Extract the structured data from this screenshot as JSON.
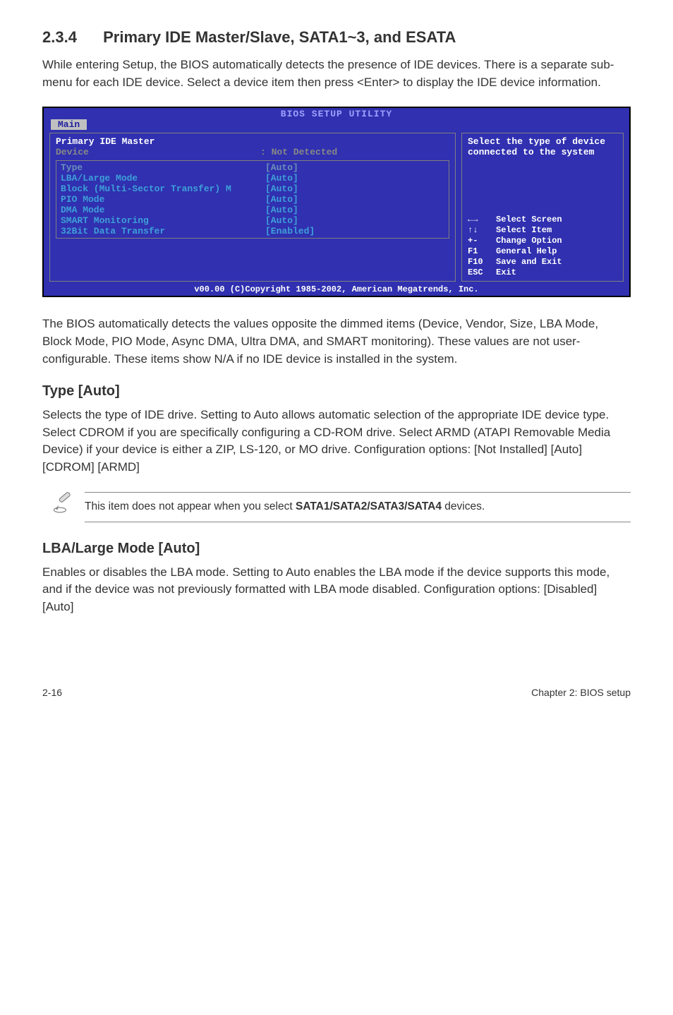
{
  "section": {
    "number": "2.3.4",
    "title": "Primary IDE Master/Slave, SATA1~3, and ESATA"
  },
  "intro": "While entering Setup, the BIOS automatically detects the presence of IDE devices. There is a separate sub-menu for each IDE device. Select a device item then press <Enter> to display the IDE device information.",
  "bios": {
    "utilityTitle": "BIOS SETUP UTILITY",
    "tab": "Main",
    "leftHeader": "Primary IDE Master",
    "deviceLabel": "Device",
    "deviceValue": ": Not Detected",
    "rows": [
      {
        "label": "Type",
        "value": "[Auto]",
        "dim": true
      },
      {
        "label": "LBA/Large Mode",
        "value": "[Auto]"
      },
      {
        "label": "Block (Multi-Sector Transfer) M",
        "value": "[Auto]"
      },
      {
        "label": "PIO Mode",
        "value": "[Auto]"
      },
      {
        "label": "DMA Mode",
        "value": "[Auto]"
      },
      {
        "label": "SMART Monitoring",
        "value": "[Auto]"
      },
      {
        "label": "32Bit Data Transfer",
        "value": "[Enabled]"
      }
    ],
    "rightTop": "Select the type of device connected to the system",
    "keys": [
      {
        "k": "←→",
        "v": "Select Screen"
      },
      {
        "k": "↑↓",
        "v": "Select Item"
      },
      {
        "k": "+-",
        "v": "Change Option"
      },
      {
        "k": "F1",
        "v": "General Help"
      },
      {
        "k": "F10",
        "v": "Save and Exit"
      },
      {
        "k": "ESC",
        "v": "Exit"
      }
    ],
    "footer": "v00.00 (C)Copyright 1985-2002, American Megatrends, Inc."
  },
  "para2": "The BIOS automatically detects the values opposite the dimmed items (Device, Vendor, Size, LBA Mode, Block Mode, PIO Mode, Async DMA, Ultra DMA, and SMART monitoring). These values are not user-configurable. These items show N/A if no IDE device is installed in the system.",
  "typeAuto": {
    "title": "Type [Auto]",
    "body": "Selects the type of IDE drive. Setting to Auto allows automatic selection of the appropriate IDE device type. Select CDROM if you are specifically configuring a CD-ROM drive. Select ARMD (ATAPI Removable Media Device) if your device is either a ZIP, LS-120, or MO drive. Configuration options: [Not Installed] [Auto] [CDROM] [ARMD]"
  },
  "note": {
    "prefix": "This item does not appear when you select ",
    "bold": "SATA1/SATA2/SATA3/SATA4",
    "suffix": " devices."
  },
  "lba": {
    "title": "LBA/Large Mode [Auto]",
    "body": "Enables or disables the LBA mode. Setting to Auto enables the LBA mode if the device supports this mode, and if the device was not previously formatted with LBA mode disabled. Configuration options: [Disabled] [Auto]"
  },
  "footer": {
    "left": "2-16",
    "right": "Chapter 2: BIOS setup"
  }
}
